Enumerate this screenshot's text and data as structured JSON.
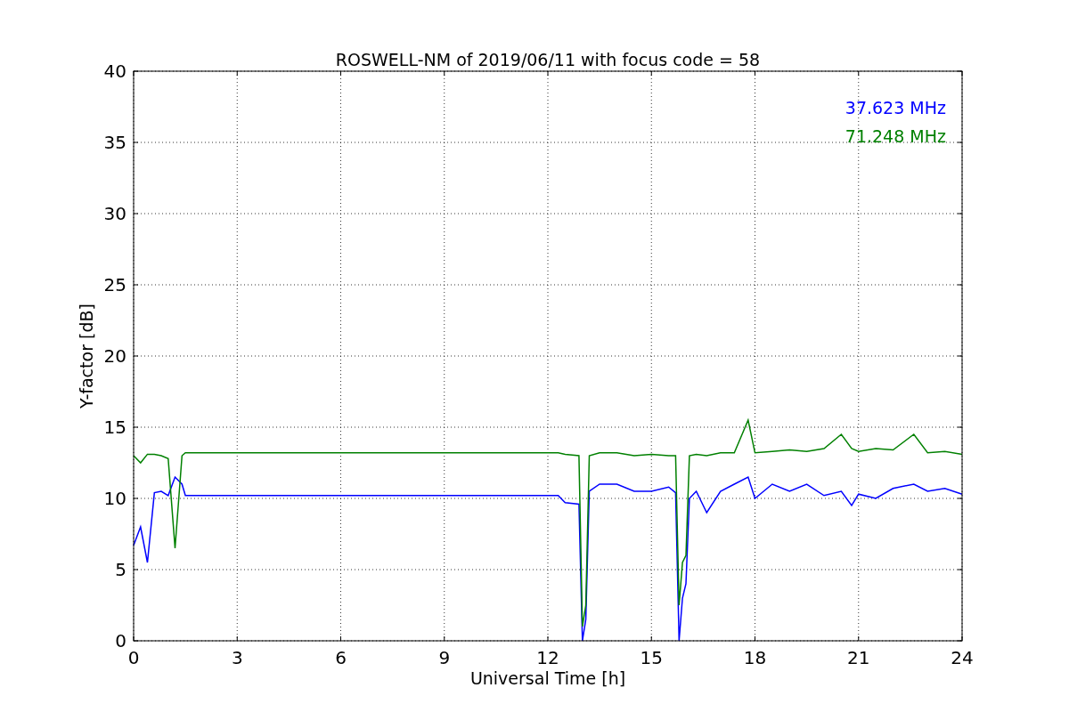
{
  "figure": {
    "chart_data": {
      "type": "line",
      "title": "ROSWELL-NM of 2019/06/11 with focus code = 58",
      "xlabel": "Universal Time [h]",
      "ylabel": "Y-factor [dB]",
      "x": [
        0,
        0.2,
        0.4,
        0.6,
        0.8,
        1.0,
        1.2,
        1.4,
        1.5,
        3,
        6,
        9,
        12.3,
        12.5,
        12.9,
        13.0,
        13.1,
        13.2,
        13.5,
        14,
        14.5,
        15,
        15.5,
        15.7,
        15.8,
        15.9,
        16.0,
        16.1,
        16.3,
        16.6,
        17,
        17.4,
        17.8,
        18,
        18.5,
        19,
        19.5,
        20,
        20.5,
        20.8,
        21,
        21.5,
        22,
        22.6,
        23,
        23.5,
        24
      ],
      "series": [
        {
          "name": "37.623 MHz",
          "color": "#0000ff",
          "values": [
            6.7,
            8,
            5.5,
            10.4,
            10.5,
            10.2,
            11.5,
            11,
            10.2,
            10.2,
            10.2,
            10.2,
            10.2,
            9.7,
            9.6,
            0,
            1.5,
            10.5,
            11,
            11,
            10.5,
            10.5,
            10.8,
            10.4,
            0,
            3,
            4,
            10,
            10.5,
            9,
            10.5,
            11,
            11.5,
            10,
            11,
            10.5,
            11,
            10.2,
            10.5,
            9.5,
            10.3,
            10,
            10.7,
            11,
            10.5,
            10.7,
            10.3
          ]
        },
        {
          "name": "71.248 MHz",
          "color": "#008000",
          "values": [
            13,
            12.5,
            13.1,
            13.1,
            13,
            12.8,
            6.5,
            13,
            13.2,
            13.2,
            13.2,
            13.2,
            13.2,
            13.1,
            13,
            1,
            2.5,
            13,
            13.2,
            13.2,
            13,
            13.1,
            13,
            13,
            2.5,
            5.5,
            6,
            13,
            13.1,
            13,
            13.2,
            13.2,
            15.5,
            13.2,
            13.3,
            13.4,
            13.3,
            13.5,
            14.5,
            13.5,
            13.3,
            13.5,
            13.4,
            14.5,
            13.2,
            13.3,
            13.1
          ]
        }
      ],
      "grid": true,
      "xlim": [
        0,
        24
      ],
      "ylim": [
        0,
        40
      ],
      "xticks": [
        0,
        3,
        6,
        9,
        12,
        15,
        18,
        21,
        24
      ],
      "yticks": [
        0,
        5,
        10,
        15,
        20,
        25,
        30,
        35,
        40
      ]
    }
  }
}
